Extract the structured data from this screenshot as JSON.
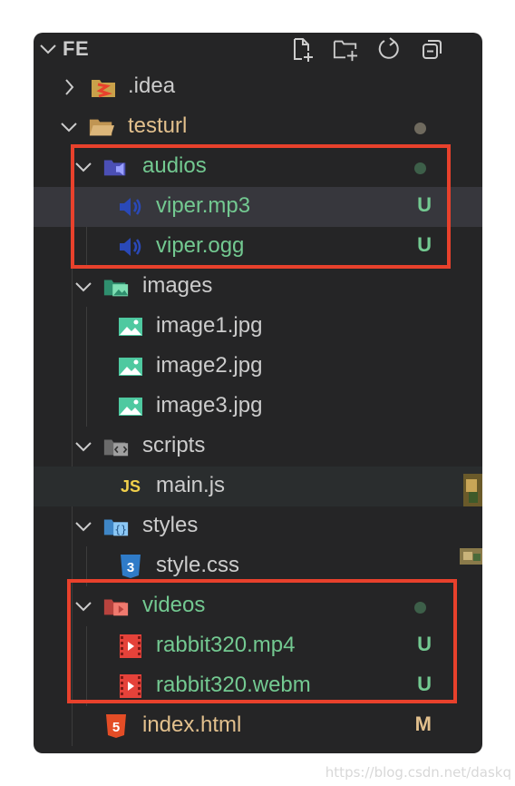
{
  "explorer": {
    "title": "FE",
    "actions": {
      "new_file": "new-file-icon",
      "new_folder": "new-folder-icon",
      "refresh": "refresh-icon",
      "collapse": "collapse-all-icon"
    }
  },
  "colors": {
    "panel_bg": "#252526",
    "text_default": "#cccccc",
    "text_untracked": "#73c991",
    "text_modified": "#e2c08d",
    "dot_gray": "#6f6a5e",
    "dot_green": "#3d5f49",
    "highlight_box": "#e8412c"
  },
  "tree": {
    "idea": {
      "label": ".idea",
      "icon": "idea-folder-icon"
    },
    "testurl": {
      "label": "testurl",
      "icon": "folder-open-icon"
    },
    "audios": {
      "label": "audios",
      "icon": "audio-folder-icon"
    },
    "viper_mp3": {
      "label": "viper.mp3",
      "status": "U",
      "icon": "audio-file-icon"
    },
    "viper_ogg": {
      "label": "viper.ogg",
      "status": "U",
      "icon": "audio-file-icon"
    },
    "images": {
      "label": "images",
      "icon": "images-folder-icon"
    },
    "image1": {
      "label": "image1.jpg",
      "icon": "image-file-icon"
    },
    "image2": {
      "label": "image2.jpg",
      "icon": "image-file-icon"
    },
    "image3": {
      "label": "image3.jpg",
      "icon": "image-file-icon"
    },
    "scripts": {
      "label": "scripts",
      "icon": "scripts-folder-icon"
    },
    "main_js": {
      "label": "main.js",
      "icon": "js-file-icon",
      "badge": "JS"
    },
    "styles": {
      "label": "styles",
      "icon": "styles-folder-icon"
    },
    "style_css": {
      "label": "style.css",
      "icon": "css-file-icon",
      "badge": "3"
    },
    "videos": {
      "label": "videos",
      "icon": "video-folder-icon"
    },
    "rabbit_mp4": {
      "label": "rabbit320.mp4",
      "status": "U",
      "icon": "video-file-icon"
    },
    "rabbit_webm": {
      "label": "rabbit320.webm",
      "status": "U",
      "icon": "video-file-icon"
    },
    "index_html": {
      "label": "index.html",
      "status": "M",
      "icon": "html-file-icon",
      "badge": "5"
    }
  },
  "watermark": "https://blog.csdn.net/daskq"
}
